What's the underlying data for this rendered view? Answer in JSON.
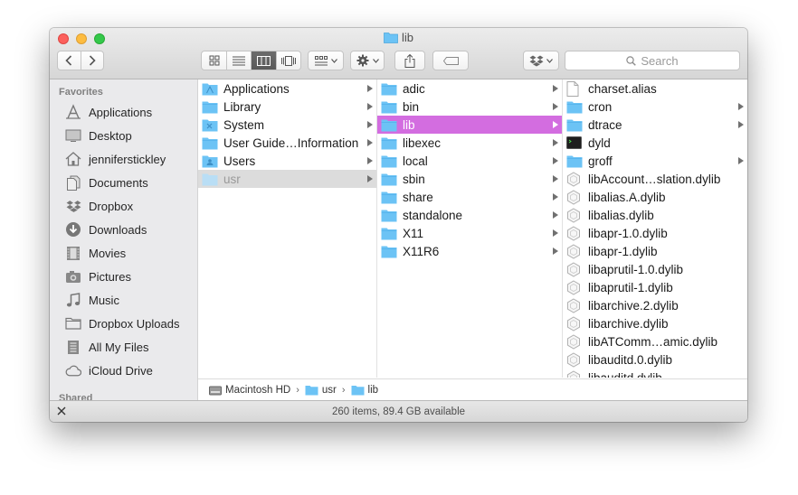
{
  "window": {
    "title": "lib"
  },
  "search": {
    "placeholder": "Search"
  },
  "sidebar": {
    "favorites_heading": "Favorites",
    "shared_heading": "Shared",
    "items": [
      {
        "label": "Applications",
        "icon": "applications-icon"
      },
      {
        "label": "Desktop",
        "icon": "desktop-icon"
      },
      {
        "label": "jenniferstickley",
        "icon": "home-icon"
      },
      {
        "label": "Documents",
        "icon": "documents-icon"
      },
      {
        "label": "Dropbox",
        "icon": "dropbox-icon"
      },
      {
        "label": "Downloads",
        "icon": "downloads-icon"
      },
      {
        "label": "Movies",
        "icon": "movies-icon"
      },
      {
        "label": "Pictures",
        "icon": "pictures-icon"
      },
      {
        "label": "Music",
        "icon": "music-icon"
      },
      {
        "label": "Dropbox Uploads",
        "icon": "folder-icon"
      },
      {
        "label": "All My Files",
        "icon": "all-files-icon"
      },
      {
        "label": "iCloud Drive",
        "icon": "cloud-icon"
      }
    ]
  },
  "columns": {
    "col1": [
      {
        "label": "Applications",
        "kind": "folder",
        "arrow": true
      },
      {
        "label": "Library",
        "kind": "folder",
        "arrow": true
      },
      {
        "label": "System",
        "kind": "folder",
        "arrow": true
      },
      {
        "label": "User Guide…Information",
        "kind": "folder",
        "arrow": true
      },
      {
        "label": "Users",
        "kind": "folder",
        "arrow": true
      },
      {
        "label": "usr",
        "kind": "folder",
        "arrow": true,
        "state": "selected-inactive"
      }
    ],
    "col2": [
      {
        "label": "adic",
        "kind": "folder",
        "arrow": true
      },
      {
        "label": "bin",
        "kind": "folder",
        "arrow": true
      },
      {
        "label": "lib",
        "kind": "folder",
        "arrow": true,
        "state": "selected-active"
      },
      {
        "label": "libexec",
        "kind": "folder",
        "arrow": true
      },
      {
        "label": "local",
        "kind": "folder",
        "arrow": true
      },
      {
        "label": "sbin",
        "kind": "folder",
        "arrow": true
      },
      {
        "label": "share",
        "kind": "folder",
        "arrow": true
      },
      {
        "label": "standalone",
        "kind": "folder",
        "arrow": true
      },
      {
        "label": "X11",
        "kind": "folder",
        "arrow": true
      },
      {
        "label": "X11R6",
        "kind": "folder",
        "arrow": true
      }
    ],
    "col3": [
      {
        "label": "charset.alias",
        "kind": "doc",
        "arrow": false
      },
      {
        "label": "cron",
        "kind": "folder",
        "arrow": true
      },
      {
        "label": "dtrace",
        "kind": "folder",
        "arrow": true
      },
      {
        "label": "dyld",
        "kind": "exec",
        "arrow": false
      },
      {
        "label": "groff",
        "kind": "folder",
        "arrow": true
      },
      {
        "label": "libAccount…slation.dylib",
        "kind": "dylib",
        "arrow": false
      },
      {
        "label": "libalias.A.dylib",
        "kind": "dylib",
        "arrow": false
      },
      {
        "label": "libalias.dylib",
        "kind": "dylib",
        "arrow": false
      },
      {
        "label": "libapr-1.0.dylib",
        "kind": "dylib",
        "arrow": false
      },
      {
        "label": "libapr-1.dylib",
        "kind": "dylib",
        "arrow": false
      },
      {
        "label": "libaprutil-1.0.dylib",
        "kind": "dylib",
        "arrow": false
      },
      {
        "label": "libaprutil-1.dylib",
        "kind": "dylib",
        "arrow": false
      },
      {
        "label": "libarchive.2.dylib",
        "kind": "dylib",
        "arrow": false
      },
      {
        "label": "libarchive.dylib",
        "kind": "dylib",
        "arrow": false
      },
      {
        "label": "libATComm…amic.dylib",
        "kind": "dylib",
        "arrow": false
      },
      {
        "label": "libauditd.0.dylib",
        "kind": "dylib",
        "arrow": false
      },
      {
        "label": "libauditd.dylib",
        "kind": "dylib",
        "arrow": false
      }
    ]
  },
  "pathbar": {
    "items": [
      {
        "label": "Macintosh HD",
        "icon": "hard-drive-icon"
      },
      {
        "label": "usr",
        "icon": "folder-icon"
      },
      {
        "label": "lib",
        "icon": "folder-icon"
      }
    ]
  },
  "status": {
    "text": "260 items, 89.4 GB available"
  },
  "colors": {
    "selection_active": "#d36de0",
    "selection_inactive": "#dcdcdc",
    "folder_blue": "#6cc3f5"
  }
}
